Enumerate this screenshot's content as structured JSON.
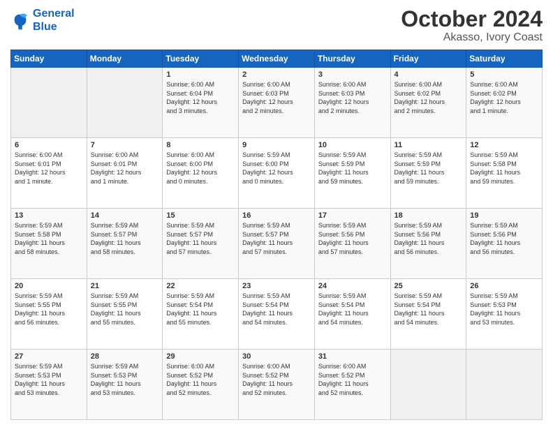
{
  "logo": {
    "line1": "General",
    "line2": "Blue"
  },
  "title": "October 2024",
  "subtitle": "Akasso, Ivory Coast",
  "days_of_week": [
    "Sunday",
    "Monday",
    "Tuesday",
    "Wednesday",
    "Thursday",
    "Friday",
    "Saturday"
  ],
  "weeks": [
    [
      {
        "day": "",
        "info": ""
      },
      {
        "day": "",
        "info": ""
      },
      {
        "day": "1",
        "info": "Sunrise: 6:00 AM\nSunset: 6:04 PM\nDaylight: 12 hours\nand 3 minutes."
      },
      {
        "day": "2",
        "info": "Sunrise: 6:00 AM\nSunset: 6:03 PM\nDaylight: 12 hours\nand 2 minutes."
      },
      {
        "day": "3",
        "info": "Sunrise: 6:00 AM\nSunset: 6:03 PM\nDaylight: 12 hours\nand 2 minutes."
      },
      {
        "day": "4",
        "info": "Sunrise: 6:00 AM\nSunset: 6:02 PM\nDaylight: 12 hours\nand 2 minutes."
      },
      {
        "day": "5",
        "info": "Sunrise: 6:00 AM\nSunset: 6:02 PM\nDaylight: 12 hours\nand 1 minute."
      }
    ],
    [
      {
        "day": "6",
        "info": "Sunrise: 6:00 AM\nSunset: 6:01 PM\nDaylight: 12 hours\nand 1 minute."
      },
      {
        "day": "7",
        "info": "Sunrise: 6:00 AM\nSunset: 6:01 PM\nDaylight: 12 hours\nand 1 minute."
      },
      {
        "day": "8",
        "info": "Sunrise: 6:00 AM\nSunset: 6:00 PM\nDaylight: 12 hours\nand 0 minutes."
      },
      {
        "day": "9",
        "info": "Sunrise: 5:59 AM\nSunset: 6:00 PM\nDaylight: 12 hours\nand 0 minutes."
      },
      {
        "day": "10",
        "info": "Sunrise: 5:59 AM\nSunset: 5:59 PM\nDaylight: 11 hours\nand 59 minutes."
      },
      {
        "day": "11",
        "info": "Sunrise: 5:59 AM\nSunset: 5:59 PM\nDaylight: 11 hours\nand 59 minutes."
      },
      {
        "day": "12",
        "info": "Sunrise: 5:59 AM\nSunset: 5:58 PM\nDaylight: 11 hours\nand 59 minutes."
      }
    ],
    [
      {
        "day": "13",
        "info": "Sunrise: 5:59 AM\nSunset: 5:58 PM\nDaylight: 11 hours\nand 58 minutes."
      },
      {
        "day": "14",
        "info": "Sunrise: 5:59 AM\nSunset: 5:57 PM\nDaylight: 11 hours\nand 58 minutes."
      },
      {
        "day": "15",
        "info": "Sunrise: 5:59 AM\nSunset: 5:57 PM\nDaylight: 11 hours\nand 57 minutes."
      },
      {
        "day": "16",
        "info": "Sunrise: 5:59 AM\nSunset: 5:57 PM\nDaylight: 11 hours\nand 57 minutes."
      },
      {
        "day": "17",
        "info": "Sunrise: 5:59 AM\nSunset: 5:56 PM\nDaylight: 11 hours\nand 57 minutes."
      },
      {
        "day": "18",
        "info": "Sunrise: 5:59 AM\nSunset: 5:56 PM\nDaylight: 11 hours\nand 56 minutes."
      },
      {
        "day": "19",
        "info": "Sunrise: 5:59 AM\nSunset: 5:56 PM\nDaylight: 11 hours\nand 56 minutes."
      }
    ],
    [
      {
        "day": "20",
        "info": "Sunrise: 5:59 AM\nSunset: 5:55 PM\nDaylight: 11 hours\nand 56 minutes."
      },
      {
        "day": "21",
        "info": "Sunrise: 5:59 AM\nSunset: 5:55 PM\nDaylight: 11 hours\nand 55 minutes."
      },
      {
        "day": "22",
        "info": "Sunrise: 5:59 AM\nSunset: 5:54 PM\nDaylight: 11 hours\nand 55 minutes."
      },
      {
        "day": "23",
        "info": "Sunrise: 5:59 AM\nSunset: 5:54 PM\nDaylight: 11 hours\nand 54 minutes."
      },
      {
        "day": "24",
        "info": "Sunrise: 5:59 AM\nSunset: 5:54 PM\nDaylight: 11 hours\nand 54 minutes."
      },
      {
        "day": "25",
        "info": "Sunrise: 5:59 AM\nSunset: 5:54 PM\nDaylight: 11 hours\nand 54 minutes."
      },
      {
        "day": "26",
        "info": "Sunrise: 5:59 AM\nSunset: 5:53 PM\nDaylight: 11 hours\nand 53 minutes."
      }
    ],
    [
      {
        "day": "27",
        "info": "Sunrise: 5:59 AM\nSunset: 5:53 PM\nDaylight: 11 hours\nand 53 minutes."
      },
      {
        "day": "28",
        "info": "Sunrise: 5:59 AM\nSunset: 5:53 PM\nDaylight: 11 hours\nand 53 minutes."
      },
      {
        "day": "29",
        "info": "Sunrise: 6:00 AM\nSunset: 5:52 PM\nDaylight: 11 hours\nand 52 minutes."
      },
      {
        "day": "30",
        "info": "Sunrise: 6:00 AM\nSunset: 5:52 PM\nDaylight: 11 hours\nand 52 minutes."
      },
      {
        "day": "31",
        "info": "Sunrise: 6:00 AM\nSunset: 5:52 PM\nDaylight: 11 hours\nand 52 minutes."
      },
      {
        "day": "",
        "info": ""
      },
      {
        "day": "",
        "info": ""
      }
    ]
  ]
}
